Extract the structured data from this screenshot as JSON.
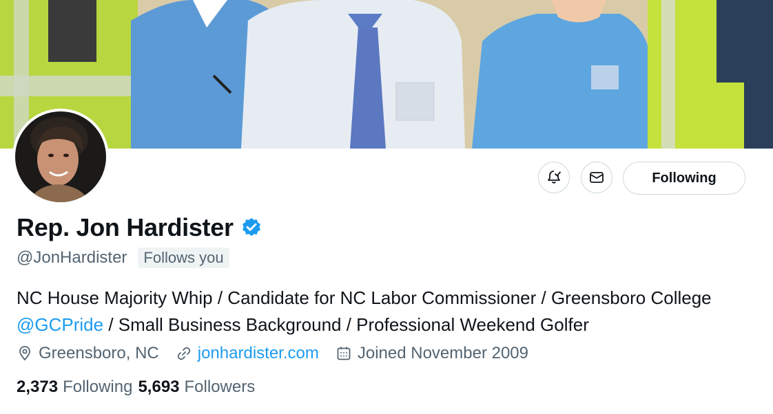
{
  "banner": {
    "description_icon": "banner-photo"
  },
  "avatar": {
    "icon": "profile-photo"
  },
  "actions": {
    "notify_icon": "bell-plus-icon",
    "message_icon": "envelope-icon",
    "follow_label": "Following"
  },
  "profile": {
    "name": "Rep. Jon Hardister",
    "handle": "@JonHardister",
    "follows_you": "Follows you",
    "bio": {
      "part1": "NC House Majority Whip / Candidate for NC Labor Commissioner / Greensboro College ",
      "mention": "@GCPride",
      "part2": " / Small Business Background / Professional Weekend Golfer"
    },
    "location": "Greensboro, NC",
    "website": "jonhardister.com",
    "joined": "Joined November 2009"
  },
  "stats": {
    "following_count": "2,373",
    "following_label": "Following",
    "followers_count": "5,693",
    "followers_label": "Followers"
  },
  "colors": {
    "accent": "#1d9bf0",
    "text": "#0f1419",
    "muted": "#536471",
    "border": "#cfd9de"
  }
}
